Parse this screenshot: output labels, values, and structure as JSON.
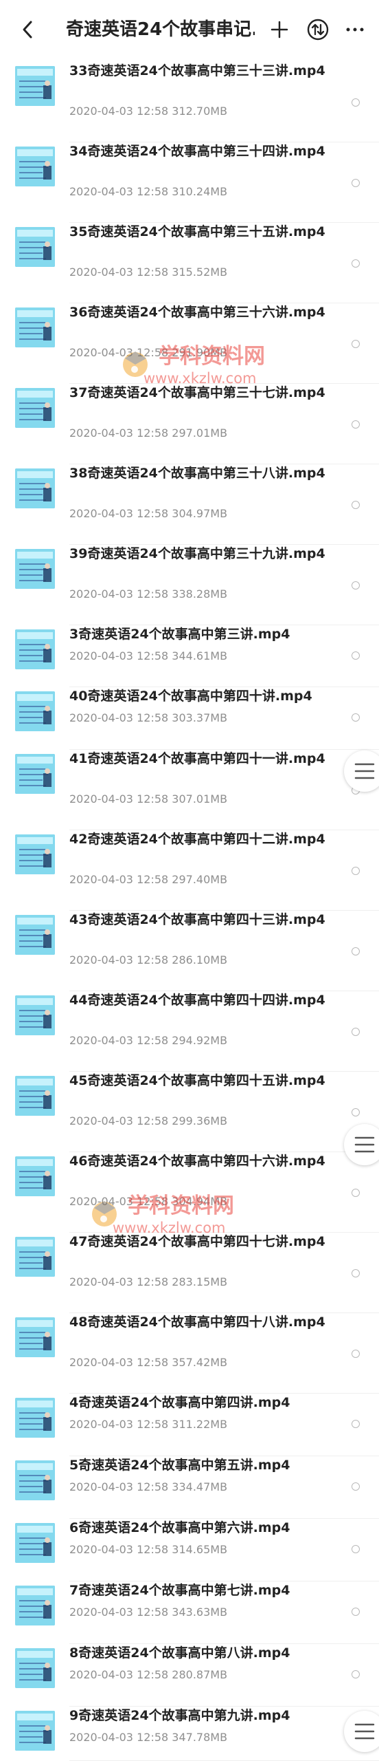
{
  "header": {
    "title": "奇速英语24个故事串记...",
    "icons": [
      "back-icon",
      "plus-icon",
      "sort-icon",
      "more-icon"
    ]
  },
  "files": [
    {
      "name": "33奇速英语24个故事高中第三十三讲.mp4",
      "date": "2020-04-03",
      "time": "12:58",
      "size": "312.70MB"
    },
    {
      "name": "34奇速英语24个故事高中第三十四讲.mp4",
      "date": "2020-04-03",
      "time": "12:58",
      "size": "310.24MB"
    },
    {
      "name": "35奇速英语24个故事高中第三十五讲.mp4",
      "date": "2020-04-03",
      "time": "12:58",
      "size": "315.52MB"
    },
    {
      "name": "36奇速英语24个故事高中第三十六讲.mp4",
      "date": "2020-04-03",
      "time": "12:58",
      "size": "291.90MB"
    },
    {
      "name": "37奇速英语24个故事高中第三十七讲.mp4",
      "date": "2020-04-03",
      "time": "12:58",
      "size": "297.01MB"
    },
    {
      "name": "38奇速英语24个故事高中第三十八讲.mp4",
      "date": "2020-04-03",
      "time": "12:58",
      "size": "304.97MB"
    },
    {
      "name": "39奇速英语24个故事高中第三十九讲.mp4",
      "date": "2020-04-03",
      "time": "12:58",
      "size": "338.28MB"
    },
    {
      "name": "3奇速英语24个故事高中第三讲.mp4",
      "date": "2020-04-03",
      "time": "12:58",
      "size": "344.61MB"
    },
    {
      "name": "40奇速英语24个故事高中第四十讲.mp4",
      "date": "2020-04-03",
      "time": "12:58",
      "size": "303.37MB"
    },
    {
      "name": "41奇速英语24个故事高中第四十一讲.mp4",
      "date": "2020-04-03",
      "time": "12:58",
      "size": "307.01MB"
    },
    {
      "name": "42奇速英语24个故事高中第四十二讲.mp4",
      "date": "2020-04-03",
      "time": "12:58",
      "size": "297.40MB"
    },
    {
      "name": "43奇速英语24个故事高中第四十三讲.mp4",
      "date": "2020-04-03",
      "time": "12:58",
      "size": "286.10MB"
    },
    {
      "name": "44奇速英语24个故事高中第四十四讲.mp4",
      "date": "2020-04-03",
      "time": "12:58",
      "size": "294.92MB"
    },
    {
      "name": "45奇速英语24个故事高中第四十五讲.mp4",
      "date": "2020-04-03",
      "time": "12:58",
      "size": "299.36MB"
    },
    {
      "name": "46奇速英语24个故事高中第四十六讲.mp4",
      "date": "2020-04-03",
      "time": "12:58",
      "size": "304.94MB"
    },
    {
      "name": "47奇速英语24个故事高中第四十七讲.mp4",
      "date": "2020-04-03",
      "time": "12:58",
      "size": "283.15MB"
    },
    {
      "name": "48奇速英语24个故事高中第四十八讲.mp4",
      "date": "2020-04-03",
      "time": "12:58",
      "size": "357.42MB"
    },
    {
      "name": "4奇速英语24个故事高中第四讲.mp4",
      "date": "2020-04-03",
      "time": "12:58",
      "size": "311.22MB"
    },
    {
      "name": "5奇速英语24个故事高中第五讲.mp4",
      "date": "2020-04-03",
      "time": "12:58",
      "size": "334.47MB"
    },
    {
      "name": "6奇速英语24个故事高中第六讲.mp4",
      "date": "2020-04-03",
      "time": "12:58",
      "size": "314.65MB"
    },
    {
      "name": "7奇速英语24个故事高中第七讲.mp4",
      "date": "2020-04-03",
      "time": "12:58",
      "size": "343.63MB"
    },
    {
      "name": "8奇速英语24个故事高中第八讲.mp4",
      "date": "2020-04-03",
      "time": "12:58",
      "size": "280.87MB"
    },
    {
      "name": "9奇速英语24个故事高中第九讲.mp4",
      "date": "2020-04-03",
      "time": "12:58",
      "size": "347.78MB"
    }
  ],
  "watermark": {
    "title": "学科资料网",
    "url": "www.xkzlw.com"
  },
  "colors": {
    "text_primary": "#222222",
    "text_secondary": "#8f8f8f",
    "divider": "#efefef",
    "radio": "#b9b9b9",
    "thumbnail": "#7fd0e6",
    "watermark_red": "#e93d36",
    "watermark_orange": "#f2a72e"
  }
}
